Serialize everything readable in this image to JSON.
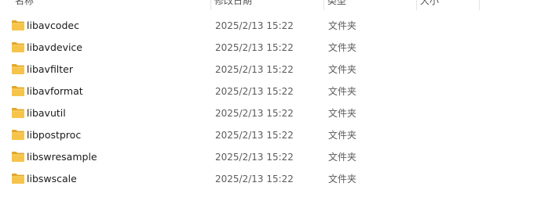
{
  "columns": {
    "name": "名称",
    "modified": "修改日期",
    "type": "类型",
    "size": "大小"
  },
  "folder_color": "#f6c44a",
  "files": [
    {
      "name": "libavcodec",
      "modified": "2025/2/13 15:22",
      "type": "文件夹",
      "size": "",
      "icon": "folder-icon"
    },
    {
      "name": "libavdevice",
      "modified": "2025/2/13 15:22",
      "type": "文件夹",
      "size": "",
      "icon": "folder-icon"
    },
    {
      "name": "libavfilter",
      "modified": "2025/2/13 15:22",
      "type": "文件夹",
      "size": "",
      "icon": "folder-icon"
    },
    {
      "name": "libavformat",
      "modified": "2025/2/13 15:22",
      "type": "文件夹",
      "size": "",
      "icon": "folder-icon"
    },
    {
      "name": "libavutil",
      "modified": "2025/2/13 15:22",
      "type": "文件夹",
      "size": "",
      "icon": "folder-icon"
    },
    {
      "name": "libpostproc",
      "modified": "2025/2/13 15:22",
      "type": "文件夹",
      "size": "",
      "icon": "folder-icon"
    },
    {
      "name": "libswresample",
      "modified": "2025/2/13 15:22",
      "type": "文件夹",
      "size": "",
      "icon": "folder-icon"
    },
    {
      "name": "libswscale",
      "modified": "2025/2/13 15:22",
      "type": "文件夹",
      "size": "",
      "icon": "folder-icon"
    }
  ]
}
